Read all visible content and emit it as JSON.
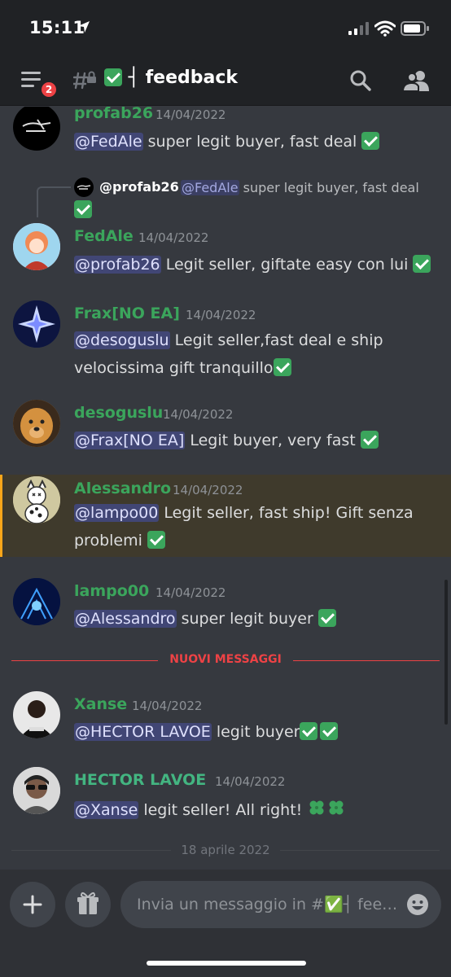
{
  "status_bar": {
    "time": "15:11"
  },
  "header": {
    "menu_badge": "2",
    "channel_name": "┤ feedback"
  },
  "messages": [
    {
      "author": "profab26",
      "timestamp": "14/04/2022",
      "mention": "@FedAle",
      "text": " super legit buyer, fast deal "
    },
    {
      "reply": {
        "author": "@profab26",
        "mention": "@FedAle",
        "text": " super legit buyer, fast deal"
      },
      "author": "FedAle",
      "timestamp": "14/04/2022",
      "mention": "@profab26",
      "text": " Legit seller, giftate easy con lui "
    },
    {
      "author": "Frax[NO EA]",
      "timestamp": "14/04/2022",
      "mention": "@desoguslu",
      "text": " Legit seller,fast deal e ship",
      "text2": "velocissima gift tranquillo"
    },
    {
      "author": "desoguslu",
      "timestamp": "14/04/2022",
      "mention": "@Frax[NO EA]",
      "text": " Legit buyer, very fast "
    },
    {
      "author": "Alessandro",
      "timestamp": "14/04/2022",
      "mention": "@lampo00",
      "text": " Legit seller, fast ship! Gift senza",
      "text2": "problemi "
    },
    {
      "author": "lampo00",
      "timestamp": "14/04/2022",
      "mention": "@Alessandro",
      "text": " super legit buyer "
    },
    {
      "author": "Xanse",
      "timestamp": "14/04/2022",
      "mention": "@HECTOR LAVOE",
      "text": " legit buyer"
    },
    {
      "author": "HECTOR LAVOE",
      "timestamp": "14/04/2022",
      "mention": "@Xanse",
      "text": " legit seller! All right! "
    }
  ],
  "new_messages_divider": "NUOVI MESSAGGI",
  "date_divider": "18 aprile 2022",
  "composer": {
    "placeholder": "Invia un messaggio in #✅┤ fee…"
  },
  "colors": {
    "mention_bg": "#414675",
    "author_green": "#3ba55c",
    "new_divider": "#ed4245",
    "highlight_bar": "#faa61a"
  }
}
